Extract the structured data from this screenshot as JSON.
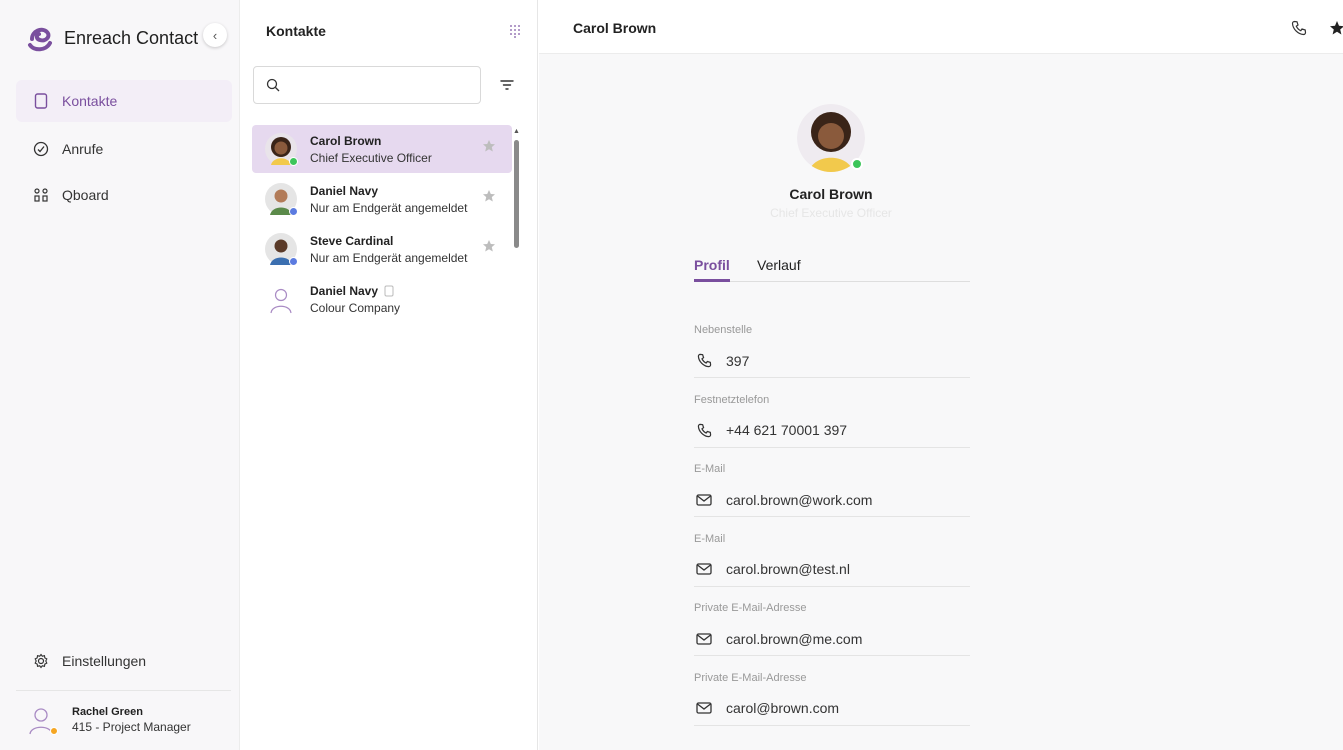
{
  "app": {
    "name": "Enreach Contact",
    "accent_color": "#7a4f9e"
  },
  "sidebar": {
    "items": [
      {
        "label": "Kontakte",
        "icon": "phonebook-icon",
        "active": true
      },
      {
        "label": "Anrufe",
        "icon": "call-history-icon",
        "active": false
      },
      {
        "label": "Qboard",
        "icon": "qboard-icon",
        "active": false
      }
    ],
    "settings_label": "Einstellungen",
    "user": {
      "name": "Rachel Green",
      "role": "415  - Project Manager",
      "status_color": "#f5a623"
    }
  },
  "contacts": {
    "title": "Kontakte",
    "search": {
      "value": "",
      "placeholder": ""
    },
    "items": [
      {
        "name": "Carol Brown",
        "subtitle": "Chief Executive Officer",
        "status_color": "#3cc55a",
        "selected": true
      },
      {
        "name": "Daniel Navy",
        "subtitle": "Nur am Endgerät angemeldet",
        "status_color": "#5b7be0",
        "selected": false
      },
      {
        "name": "Steve Cardinal",
        "subtitle": "Nur am Endgerät angemeldet",
        "status_color": "#5b7be0",
        "selected": false
      },
      {
        "name": "Daniel Navy",
        "subtitle": "Colour Company",
        "status_color": "",
        "selected": false
      }
    ]
  },
  "detail": {
    "header_title": "Carol Brown",
    "profile": {
      "name": "Carol Brown",
      "subtitle": "Chief Executive Officer",
      "status_color": "#3cc55a"
    },
    "tabs": [
      {
        "label": "Profil",
        "active": true
      },
      {
        "label": "Verlauf",
        "active": false
      }
    ],
    "fields": [
      {
        "label": "Nebenstelle",
        "value": "397",
        "icon": "phone-icon"
      },
      {
        "label": "Festnetztelefon",
        "value": "+44 621 70001 397",
        "icon": "phone-icon"
      },
      {
        "label": "E-Mail",
        "value": "carol.brown@work.com",
        "icon": "mail-icon"
      },
      {
        "label": "E-Mail",
        "value": "carol.brown@test.nl",
        "icon": "mail-icon"
      },
      {
        "label": "Private E-Mail-Adresse",
        "value": "carol.brown@me.com",
        "icon": "mail-icon"
      },
      {
        "label": "Private E-Mail-Adresse",
        "value": "carol@brown.com",
        "icon": "mail-icon"
      }
    ]
  }
}
